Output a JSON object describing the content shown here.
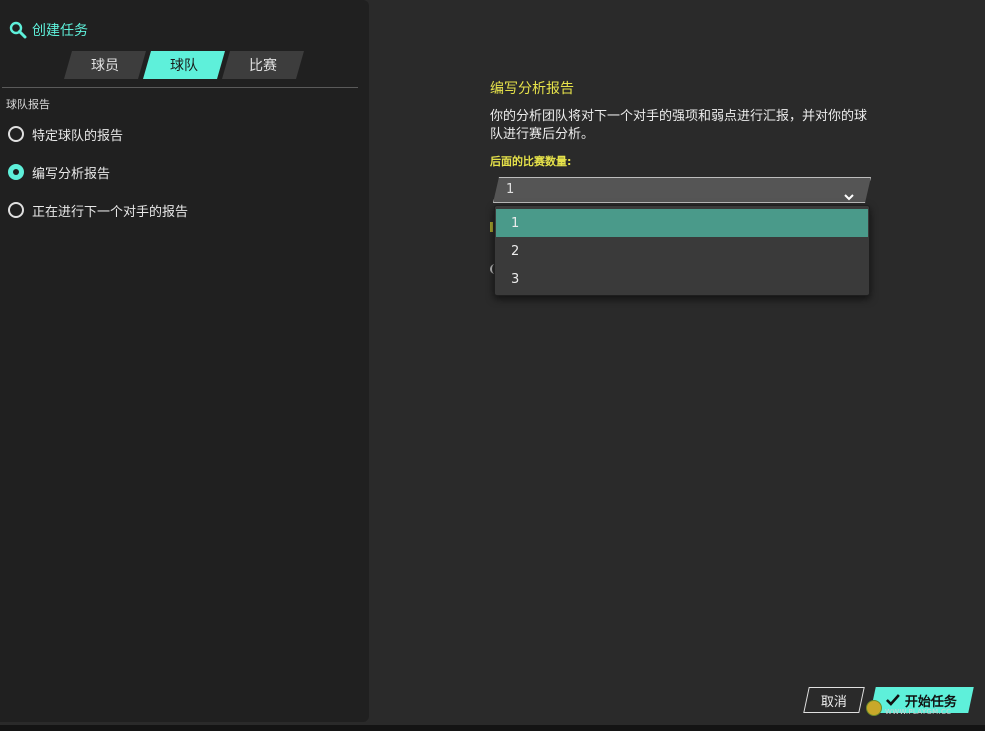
{
  "header": {
    "title": "创建任务",
    "icon": "search-icon"
  },
  "tabs": [
    {
      "label": "球员",
      "active": false
    },
    {
      "label": "球队",
      "active": true
    },
    {
      "label": "比赛",
      "active": false
    }
  ],
  "section_label": "球队报告",
  "options": [
    {
      "label": "特定球队的报告",
      "selected": false
    },
    {
      "label": "编写分析报告",
      "selected": true
    },
    {
      "label": "正在进行下一个对手的报告",
      "selected": false
    }
  ],
  "content": {
    "title": "编写分析报告",
    "description": "你的分析团队将对下一个对手的强项和弱点进行汇报，并对你的球队进行赛后分析。",
    "field_label": "后面的比赛数量:",
    "select_value": "1",
    "dropdown_options": [
      "1",
      "2",
      "3"
    ],
    "highlighted_option": "1"
  },
  "buttons": {
    "cancel": "取消",
    "start": "开始任务"
  },
  "watermark": "WWW.PLAYGM.CC",
  "colors": {
    "accent": "#5ef0da",
    "heading": "#e6e24a",
    "highlight": "#4a9a8a",
    "background": "#2a2a2a",
    "panel": "#202020"
  }
}
